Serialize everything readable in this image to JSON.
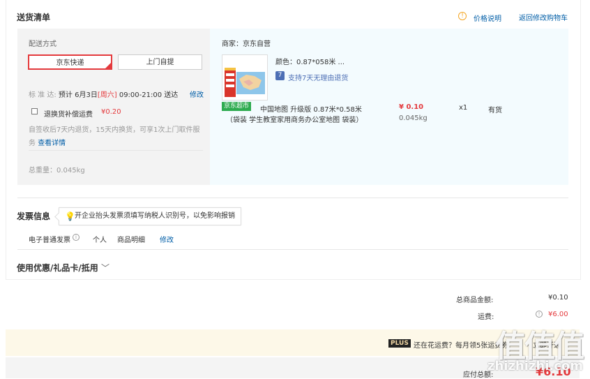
{
  "delivery": {
    "title": "送货清单",
    "price_explain": "价格说明",
    "back_to_cart": "返回修改购物车",
    "method_label": "配送方式",
    "options": [
      "京东快递",
      "上门自提"
    ],
    "standard_label": "标 准 达:",
    "estimate_prefix": "预计 6月3日",
    "weekday": "[周六]",
    "time_window": "09:00-21:00 送达",
    "modify": "修改",
    "return_insurance_label": "退换货补偿运费",
    "return_insurance_price": "¥0.20",
    "return_policy": "自签收后7天内退货，15天内换货，可享1次上门取件服务",
    "view_details": "查看详情",
    "total_weight": "总重量：0.045kg"
  },
  "item": {
    "seller": "商家：京东自营",
    "color": "颜色：0.87*058米 ...",
    "return_badge": "7",
    "return_policy": "支持7天无理由退货",
    "tag": "京东超市",
    "name": "中国地图 升级版 0.87米*0.58米",
    "name_line2": "（袋装 学生教室家用商务办公室地图 袋装）",
    "price": "¥ 0.10",
    "weight": "0.045kg",
    "qty": "x1",
    "stock": "有货"
  },
  "invoice": {
    "title": "发票信息",
    "tip": "开企业抬头发票须填写纳税人识别号，以免影响报销",
    "type": "电子普通发票",
    "holder": "个人",
    "content": "商品明细",
    "modify": "修改"
  },
  "coupon": {
    "title": "使用优惠/礼品卡/抵用"
  },
  "totals": {
    "goods_label": "总商品金额:",
    "goods_value": "¥0.10",
    "shipping_label": "运费:",
    "shipping_value": "¥6.00",
    "payable_label": "应付总额:",
    "payable_value": "¥6.10"
  },
  "plus": {
    "logo": "PLUS",
    "text": "还在花运费？每月领5张运费券",
    "link": "立即开通"
  },
  "watermark": {
    "big": "值值值",
    "small": "zhizhizhi.com"
  },
  "colors": {
    "accent": "#e4393c",
    "link": "#005ea7",
    "tag_green": "#2dab4f"
  }
}
